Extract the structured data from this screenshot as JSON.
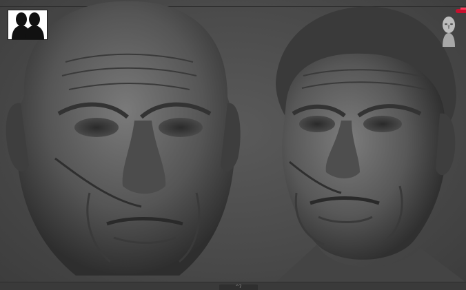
{
  "viewport": {
    "background_color": "#4a4a4a",
    "sculpt_material_color": "#5e5e5e"
  },
  "reference_thumbnail": {
    "icon": "two-head-silhouettes-icon",
    "background_color": "#ffffff",
    "silhouette_color": "#111111"
  },
  "models": [
    {
      "name_icon": "bald-head-sculpt-front-view",
      "view": "front"
    },
    {
      "name_icon": "head-with-hair-sculpt-three-quarter-view",
      "view": "three-quarter"
    }
  ],
  "navigation": {
    "orientation_icon": "head-orientation-gizmo-icon",
    "axis_color": "#c8102e"
  },
  "bottom_bar": {
    "tab_label": "^7"
  }
}
